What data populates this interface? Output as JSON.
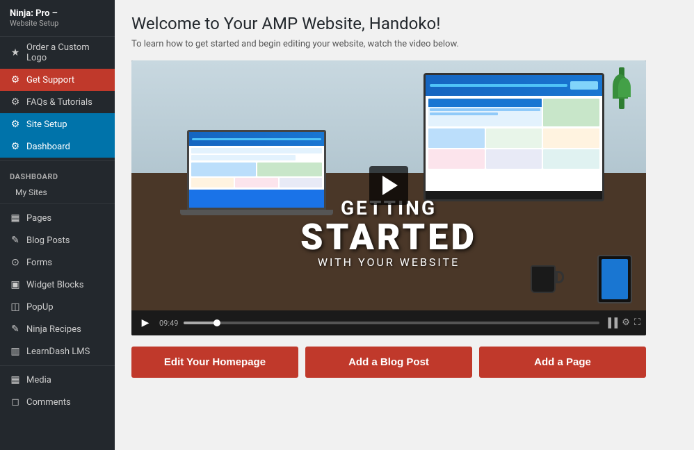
{
  "brand": {
    "name": "Ninja: Pro –",
    "sub": "Website Setup"
  },
  "sidebar": {
    "top_items": [
      {
        "id": "order-logo",
        "label": "Order a Custom Logo",
        "icon": "★"
      },
      {
        "id": "get-support",
        "label": "Get Support",
        "icon": "⚙",
        "state": "active-red"
      },
      {
        "id": "faqs",
        "label": "FAQs & Tutorials",
        "icon": "⚙"
      },
      {
        "id": "site-setup",
        "label": "Site Setup",
        "icon": "⚙",
        "state": "active-blue"
      },
      {
        "id": "dashboard",
        "label": "Dashboard",
        "icon": "⚙",
        "state": "active-blue"
      }
    ],
    "section_label": "Dashboard",
    "sub_items": [
      {
        "id": "my-sites",
        "label": "My Sites"
      }
    ],
    "main_items": [
      {
        "id": "pages",
        "label": "Pages",
        "icon": "▦"
      },
      {
        "id": "blog-posts",
        "label": "Blog Posts",
        "icon": "✎"
      },
      {
        "id": "forms",
        "label": "Forms",
        "icon": "⊙"
      },
      {
        "id": "widget-blocks",
        "label": "Widget Blocks",
        "icon": "▣"
      },
      {
        "id": "popup",
        "label": "PopUp",
        "icon": "◫"
      },
      {
        "id": "ninja-recipes",
        "label": "Ninja Recipes",
        "icon": "✎"
      },
      {
        "id": "learndash-lms",
        "label": "LearnDash LMS",
        "icon": "▥"
      }
    ],
    "bottom_items": [
      {
        "id": "media",
        "label": "Media",
        "icon": "▦"
      },
      {
        "id": "comments",
        "label": "Comments",
        "icon": "◻"
      }
    ]
  },
  "main": {
    "title": "Welcome to Your AMP Website, Handoko!",
    "subtitle": "To learn how to get started and begin editing your website, watch the video below.",
    "video": {
      "text_line1": "GETTING",
      "text_line2": "STARTED",
      "text_line3": "WITH YOUR WEBSITE",
      "time": "09:49"
    },
    "buttons": [
      {
        "id": "edit-homepage",
        "label": "Edit Your Homepage"
      },
      {
        "id": "add-blog-post",
        "label": "Add a Blog Post"
      },
      {
        "id": "add-page",
        "label": "Add a Page"
      }
    ]
  }
}
